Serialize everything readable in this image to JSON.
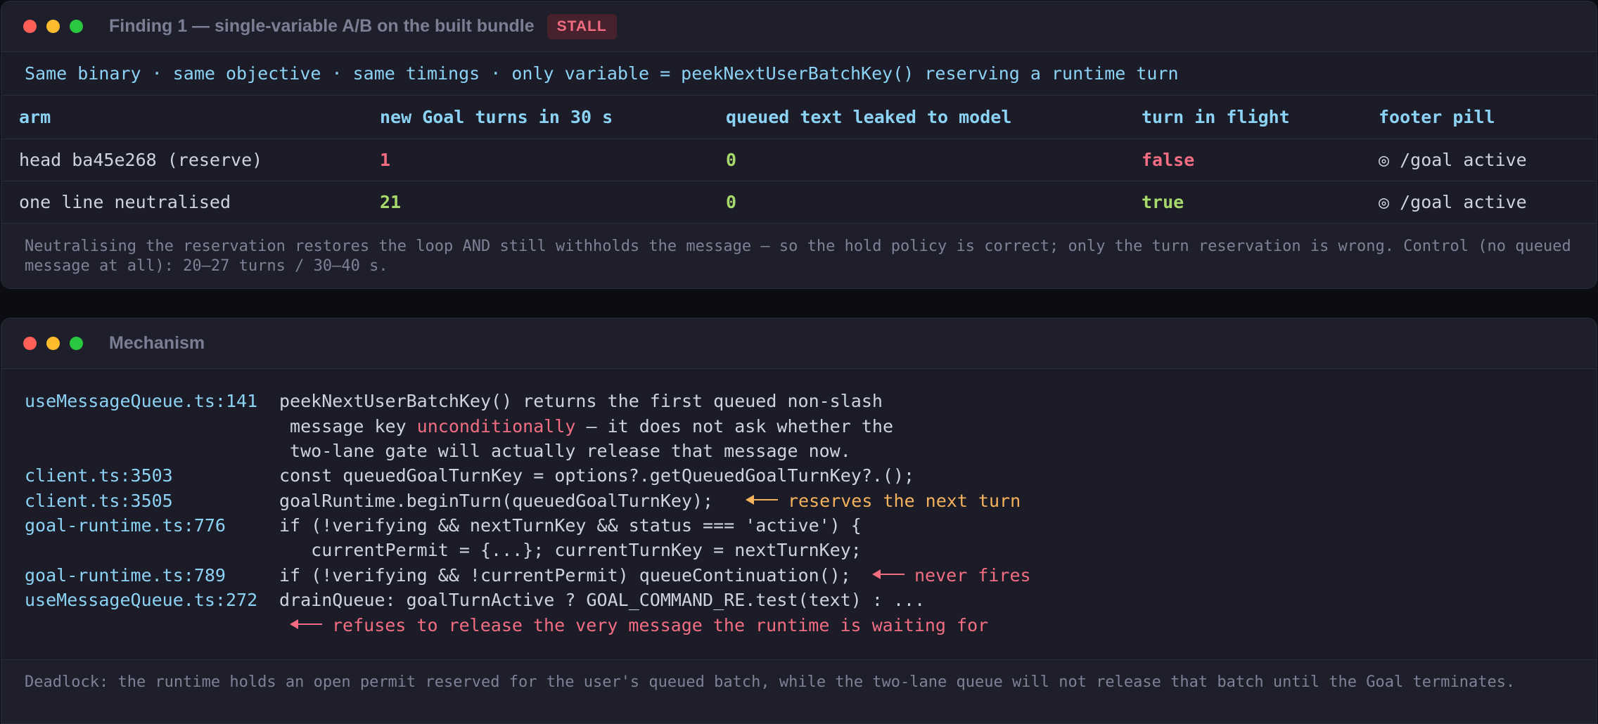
{
  "finding": {
    "title": "Finding 1 — single-variable A/B on the built bundle",
    "badge": "STALL",
    "subhead": "Same binary · same objective · same timings · only variable = peekNextUserBatchKey() reserving a runtime turn",
    "columns": [
      "arm",
      "new Goal turns in 30 s",
      "queued text leaked to model",
      "turn in flight",
      "footer pill"
    ],
    "rows": [
      {
        "arm": "head ba45e268 (reserve)",
        "turns": "1",
        "leaked": "0",
        "in_flight": "false",
        "pill": "◎ /goal active"
      },
      {
        "arm": "one line neutralised",
        "turns": "21",
        "leaked": "0",
        "in_flight": "true",
        "pill": "◎ /goal active"
      }
    ],
    "note": "Neutralising the reservation restores the loop AND still withholds the message — so the hold policy is correct; only the turn reservation is wrong. Control (no queued message at all): 20–27 turns / 30–40 s."
  },
  "mechanism": {
    "title": "Mechanism",
    "lines": [
      {
        "loc": "useMessageQueue.ts:141",
        "code": "peekNextUserBatchKey() returns the first queued non-slash"
      },
      {
        "loc": "",
        "code_a": " message key ",
        "hl": "unconditionally",
        "code_b": " — it does not ask whether the"
      },
      {
        "loc": "",
        "code": " two-lane gate will actually release that message now."
      },
      {
        "loc": "client.ts:3503",
        "code": "const queuedGoalTurnKey = options?.getQueuedGoalTurnKey?.();"
      },
      {
        "loc": "client.ts:3505",
        "code": "goalRuntime.beginTurn(queuedGoalTurnKey);",
        "annotation": "reserves the next turn"
      },
      {
        "loc": "goal-runtime.ts:776",
        "code": "if (!verifying && nextTurnKey && status === 'active') {"
      },
      {
        "loc": "",
        "code": "   currentPermit = {...}; currentTurnKey = nextTurnKey;"
      },
      {
        "loc": "goal-runtime.ts:789",
        "code": "if (!verifying && !currentPermit) queueContinuation();",
        "annotation": "never fires"
      },
      {
        "loc": "useMessageQueue.ts:272",
        "code": "drainQueue: goalTurnActive ? GOAL_COMMAND_RE.test(text) : ..."
      },
      {
        "loc": "",
        "annotation": "refuses to release the very message the runtime is waiting for"
      }
    ],
    "note": "Deadlock: the runtime holds an open permit reserved for the user's queued batch, while the two-lane queue will not release that batch until the Goal terminates."
  }
}
